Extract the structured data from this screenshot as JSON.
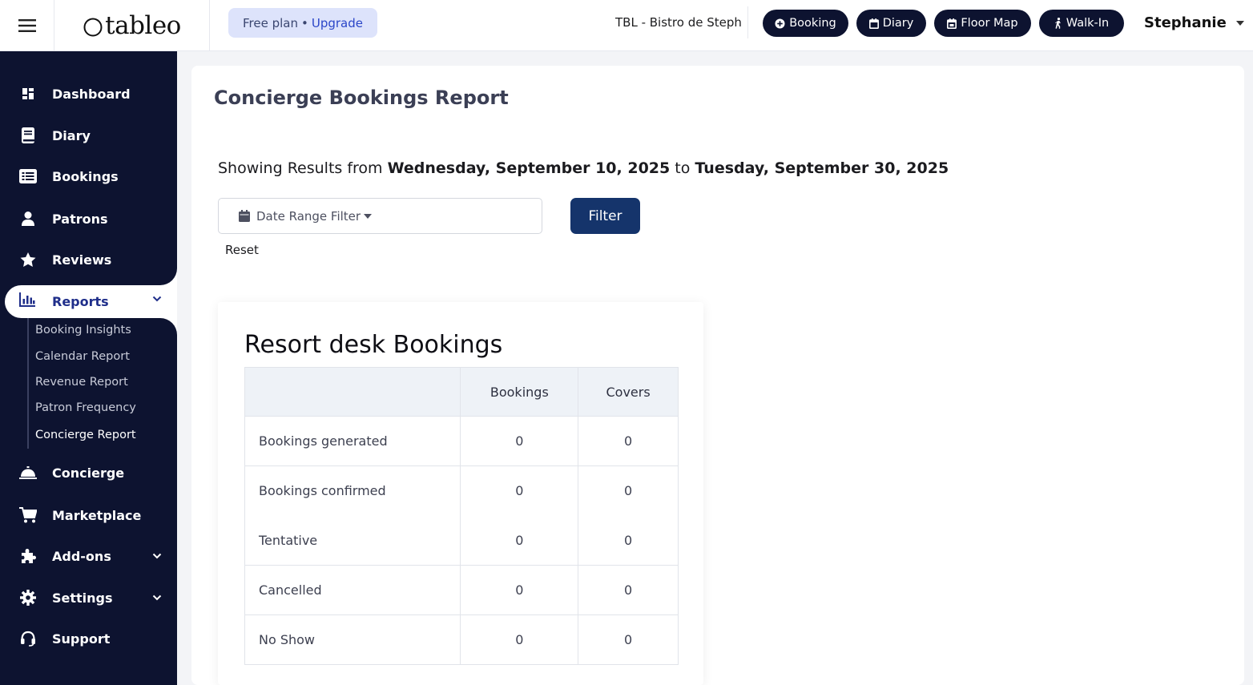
{
  "header": {
    "logo": "tableo",
    "plan_label": "Free plan",
    "plan_separator": "•",
    "upgrade_label": "Upgrade",
    "venue": "TBL - Bistro de Steph",
    "buttons": {
      "booking": "Booking",
      "diary": "Diary",
      "floor_map": "Floor Map",
      "walk_in": "Walk-In"
    },
    "user_name": "Stephanie"
  },
  "sidebar": {
    "dashboard": "Dashboard",
    "diary": "Diary",
    "bookings": "Bookings",
    "patrons": "Patrons",
    "reviews": "Reviews",
    "reports": "Reports",
    "reports_sub": {
      "booking_insights": "Booking Insights",
      "calendar_report": "Calendar Report",
      "revenue_report": "Revenue Report",
      "patron_frequency": "Patron Frequency",
      "concierge_report": "Concierge Report"
    },
    "concierge": "Concierge",
    "marketplace": "Marketplace",
    "addons": "Add-ons",
    "settings": "Settings",
    "support": "Support"
  },
  "main": {
    "title": "Concierge Bookings Report",
    "results_prefix": "Showing Results from",
    "date_from": "Wednesday, September 10, 2025",
    "results_to": "to",
    "date_to": "Tuesday, September 30, 2025",
    "date_filter_label": "Date Range Filter",
    "filter_button": "Filter",
    "reset_link": "Reset"
  },
  "report": {
    "title": "Resort desk Bookings",
    "columns": [
      "",
      "Bookings",
      "Covers"
    ],
    "rows": [
      {
        "label": "Bookings generated",
        "bookings": "0",
        "covers": "0"
      },
      {
        "label": "Bookings confirmed",
        "bookings": "0",
        "covers": "0"
      },
      {
        "label": "Tentative",
        "bookings": "0",
        "covers": "0"
      },
      {
        "label": "Cancelled",
        "bookings": "0",
        "covers": "0"
      },
      {
        "label": "No Show",
        "bookings": "0",
        "covers": "0"
      }
    ]
  },
  "colors": {
    "sidebar_bg": "#0d1330",
    "primary_button": "#15346b",
    "active_nav_text": "#1f2e8a",
    "plan_pill_bg": "#dde3fb",
    "upgrade_link": "#2b46c8"
  }
}
